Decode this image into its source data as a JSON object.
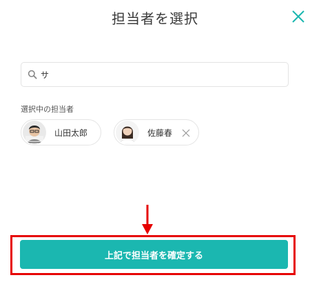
{
  "dialog": {
    "title": "担当者を選択",
    "close_icon": "close-icon",
    "accent_color": "#1bb7b0"
  },
  "search": {
    "value": "サ",
    "placeholder": "",
    "icon": "search-icon"
  },
  "selected": {
    "label": "選択中の担当者",
    "people": [
      {
        "name": "山田太郎",
        "removable": false
      },
      {
        "name": "佐藤春",
        "removable": true
      }
    ]
  },
  "footer": {
    "confirm_label": "上記で担当者を確定する",
    "annotation_color": "#e60000"
  }
}
